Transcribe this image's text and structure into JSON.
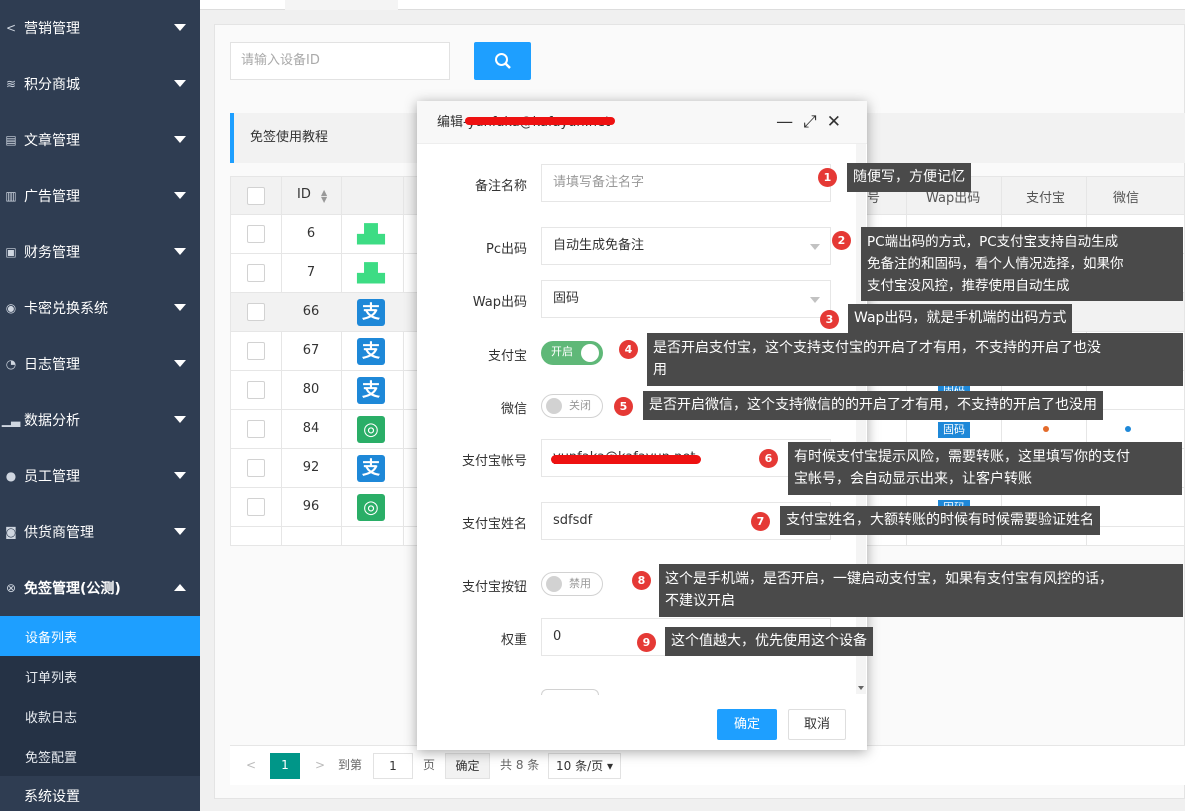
{
  "sidebar": {
    "items": [
      {
        "label": "营销管理",
        "icon": "share-icon"
      },
      {
        "label": "积分商城",
        "icon": "coins-icon"
      },
      {
        "label": "文章管理",
        "icon": "document-icon"
      },
      {
        "label": "广告管理",
        "icon": "ad-icon"
      },
      {
        "label": "财务管理",
        "icon": "wallet-icon"
      },
      {
        "label": "卡密兑换系统",
        "icon": "card-icon"
      },
      {
        "label": "日志管理",
        "icon": "clock-icon"
      },
      {
        "label": "数据分析",
        "icon": "chart-icon"
      },
      {
        "label": "员工管理",
        "icon": "user-icon"
      },
      {
        "label": "供货商管理",
        "icon": "box-icon"
      },
      {
        "label": "免签管理(公测)",
        "icon": "gear-icon"
      }
    ],
    "sub_items": [
      {
        "label": "设备列表",
        "active": true
      },
      {
        "label": "订单列表",
        "active": false
      },
      {
        "label": "收款日志",
        "active": false
      },
      {
        "label": "免签配置",
        "active": false
      }
    ],
    "next_item": "系统设置"
  },
  "search": {
    "placeholder": "请输入设备ID"
  },
  "tip_bar": "免签使用教程",
  "table": {
    "headers": {
      "id": "ID",
      "wap": "Wap出码",
      "alipay": "支付宝",
      "wechat": "微信",
      "partial": "号"
    },
    "rows": [
      {
        "id": "6",
        "type": "android"
      },
      {
        "id": "7",
        "type": "android"
      },
      {
        "id": "66",
        "type": "alipay"
      },
      {
        "id": "67",
        "type": "alipay"
      },
      {
        "id": "80",
        "type": "alipay"
      },
      {
        "id": "84",
        "type": "wechat"
      },
      {
        "id": "92",
        "type": "alipay"
      },
      {
        "id": "96",
        "type": "wechat"
      }
    ],
    "badge": "固码"
  },
  "pager": {
    "current": "1",
    "goto_label": "到第",
    "goto_value": "1",
    "page_label": "页",
    "confirm": "确定",
    "total": "共 8 条",
    "page_size": "10 条/页"
  },
  "modal": {
    "title": "编辑-yunfaka@kafayun.net",
    "fields": {
      "remark_label": "备注名称",
      "remark_placeholder": "请填写备注名字",
      "pc_label": "Pc出码",
      "pc_value": "自动生成免备注",
      "wap_label": "Wap出码",
      "wap_value": "固码",
      "alipay_label": "支付宝",
      "alipay_toggle": "开启",
      "wechat_label": "微信",
      "wechat_toggle": "关闭",
      "account_label": "支付宝帐号",
      "account_value": "yunfaka@kafayun.net",
      "name_label": "支付宝姓名",
      "name_value": "sdfsdf",
      "button_label": "支付宝按钮",
      "button_toggle": "禁用",
      "weight_label": "权重",
      "weight_value": "0"
    },
    "ok": "确定",
    "cancel": "取消"
  },
  "annotations": [
    {
      "num": "1",
      "text": "随便写，方便记忆"
    },
    {
      "num": "2",
      "text": "PC端出码的方式，PC支付宝支持自动生成\n免备注的和固码，看个人情况选择，如果你\n支付宝没风控，推荐使用自动生成"
    },
    {
      "num": "3",
      "text": "Wap出码，就是手机端的出码方式"
    },
    {
      "num": "4",
      "text": "是否开启支付宝，这个支持支付宝的开启了才有用，不支持的开启了也没\n用"
    },
    {
      "num": "5",
      "text": "是否开启微信，这个支持微信的的开启了才有用，不支持的开启了也没用"
    },
    {
      "num": "6",
      "text": "有时候支付宝提示风险，需要转账，这里填写你的支付\n宝帐号，会自动显示出来，让客户转账"
    },
    {
      "num": "7",
      "text": "支付宝姓名，大额转账的时候有时候需要验证姓名"
    },
    {
      "num": "8",
      "text": "这个是手机端，是否开启，一键启动支付宝，如果有支付宝有风控的话，\n不建议开启"
    },
    {
      "num": "9",
      "text": "这个值越大，优先使用这个设备"
    }
  ],
  "colors": {
    "accent": "#1e9fff",
    "sidebar": "#2f3d52",
    "toggle_on": "#5fb878",
    "annotation_red": "#e53935"
  }
}
